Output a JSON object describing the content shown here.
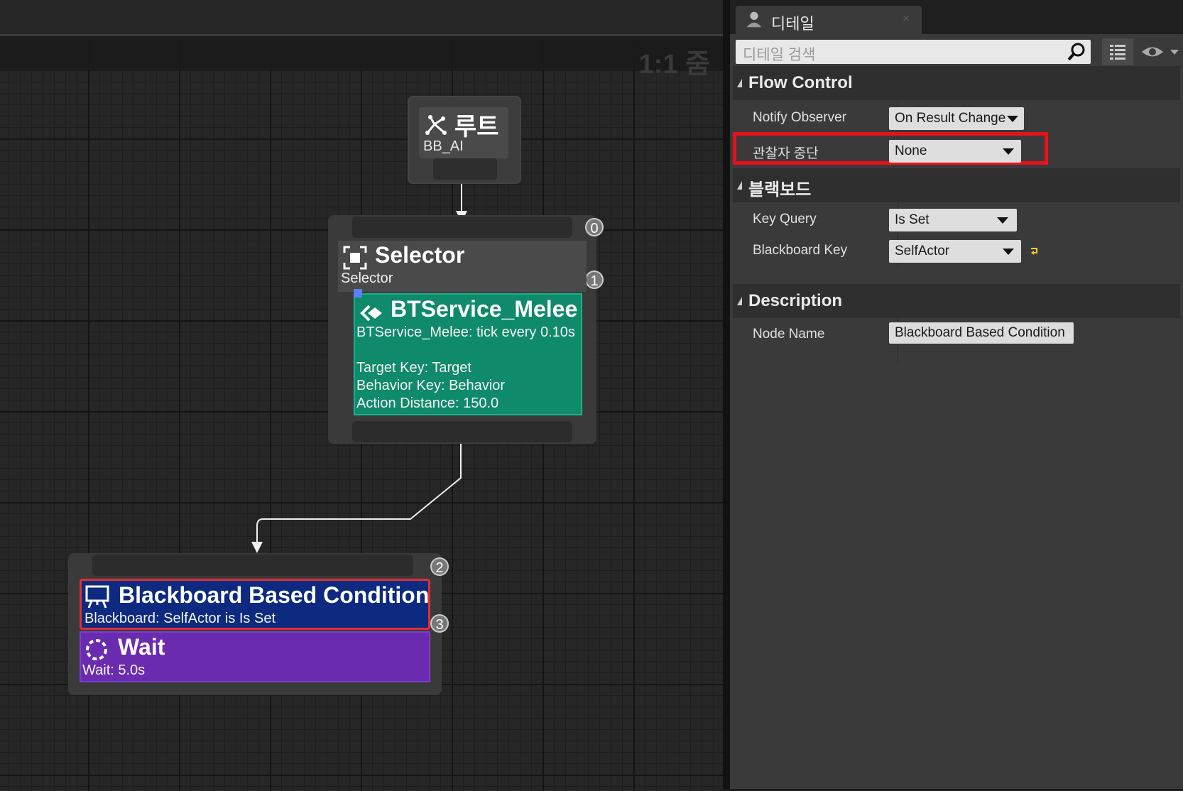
{
  "graph": {
    "zoom_label": "1:1 줌",
    "root": {
      "title": "루트",
      "subtitle": "BB_AI"
    },
    "selector": {
      "title": "Selector",
      "subtitle": "Selector",
      "badges": [
        "0",
        "1"
      ],
      "service": {
        "title": "BTService_Melee",
        "lines": [
          "BTService_Melee: tick every 0.10s",
          "",
          "Target Key: Target",
          "Behavior Key: Behavior",
          "Action Distance: 150.0"
        ]
      }
    },
    "sequence": {
      "badges": [
        "2",
        "3"
      ],
      "decorator": {
        "title": "Blackboard Based Condition",
        "subtitle": "Blackboard: SelfActor is Is Set"
      },
      "task": {
        "title": "Wait",
        "subtitle": "Wait: 5.0s"
      }
    }
  },
  "details": {
    "tab_title": "디테일",
    "search_placeholder": "디테일 검색",
    "categories": {
      "flow_control": "Flow Control",
      "blackboard": "블랙보드",
      "description": "Description"
    },
    "rows": {
      "notify_observer": {
        "label": "Notify Observer",
        "value": "On Result Change"
      },
      "observer_aborts": {
        "label": "관찰자 중단",
        "value": "None"
      },
      "key_query": {
        "label": "Key Query",
        "value": "Is Set"
      },
      "blackboard_key": {
        "label": "Blackboard Key",
        "value": "SelfActor"
      },
      "node_name": {
        "label": "Node Name",
        "value": "Blackboard Based Condition"
      }
    }
  },
  "colors": {
    "service": "#0f8a6a",
    "decorator": "#0d2a80",
    "task": "#6a2bb0",
    "highlight": "#e8101a"
  }
}
